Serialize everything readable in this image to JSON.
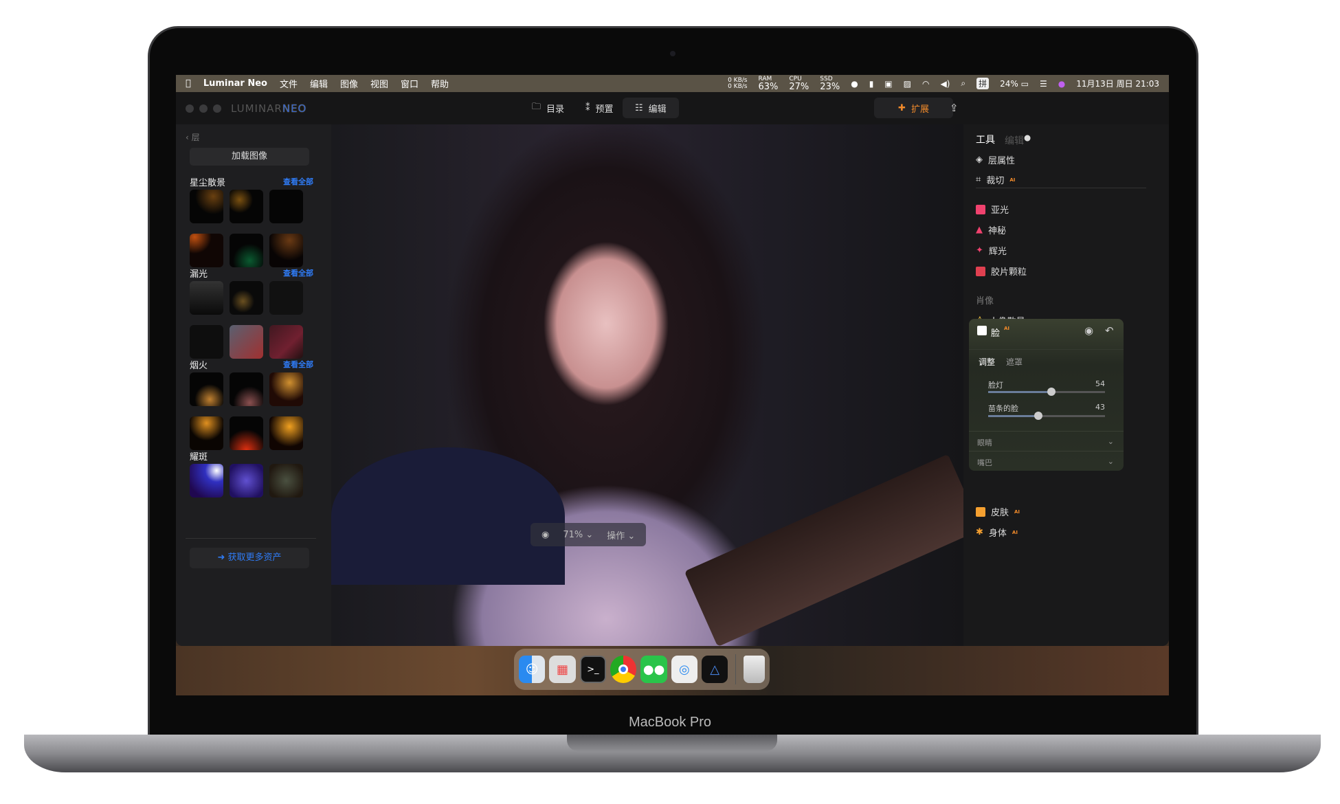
{
  "device_label": "MacBook Pro",
  "menubar": {
    "app": "Luminar Neo",
    "menus": [
      "文件",
      "编辑",
      "图像",
      "视图",
      "窗口",
      "帮助"
    ],
    "net_up": "0 KB/s",
    "net_down": "0 KB/s",
    "ram_label": "RAM",
    "ram": "63%",
    "cpu_label": "CPU",
    "cpu": "27%",
    "ssd_label": "SSD",
    "ssd": "23%",
    "ime": "拼",
    "battery": "24%",
    "datetime": "11月13日 周日 21:03"
  },
  "app": {
    "logo_a": "LUMINAR",
    "logo_b": "NEO",
    "tabs": [
      {
        "label": "目录",
        "icon": "folder-icon"
      },
      {
        "label": "预置",
        "icon": "magic-wand-icon"
      },
      {
        "label": "编辑",
        "icon": "sliders-icon",
        "active": true
      }
    ],
    "extensions": "扩展"
  },
  "left": {
    "back": "层",
    "load": "加载图像",
    "see_all": "查看全部",
    "sections": [
      "星尘散景",
      "漏光",
      "烟火",
      "耀斑"
    ],
    "more": "获取更多资产"
  },
  "viewbar": {
    "zoom": "71%",
    "actions": "操作"
  },
  "right": {
    "tab_tools": "工具",
    "tab_edits": "编辑",
    "items": [
      {
        "label": "层属性",
        "icon": "layers-icon"
      },
      {
        "label": "裁切",
        "icon": "crop-icon",
        "ai": "AI"
      },
      {
        "label": "亚光",
        "icon": "matte-icon"
      },
      {
        "label": "神秘",
        "icon": "mystical-icon"
      },
      {
        "label": "辉光",
        "icon": "sparkle-icon"
      },
      {
        "label": "胶片颗粒",
        "icon": "film-icon"
      }
    ],
    "section": "肖像",
    "portrait_bokeh": "人像散景",
    "ai": "AI",
    "face": {
      "title": "脸",
      "tab_adjust": "调整",
      "tab_mask": "遮罩",
      "sliders": [
        {
          "label": "脸灯",
          "value": 54
        },
        {
          "label": "苗条的脸",
          "value": 43
        }
      ],
      "accordions": [
        "眼睛",
        "嘴巴"
      ]
    },
    "skin": "皮肤",
    "body": "身体"
  },
  "colors": {
    "accent_blue": "#2f7bf5",
    "ai_orange": "#f28b2b",
    "creative_pink": "#f0426e",
    "portrait_orange": "#f5a030"
  },
  "dock": [
    "finder",
    "launchpad",
    "terminal",
    "chrome",
    "wechat",
    "safari",
    "luminar-neo",
    "trash"
  ]
}
